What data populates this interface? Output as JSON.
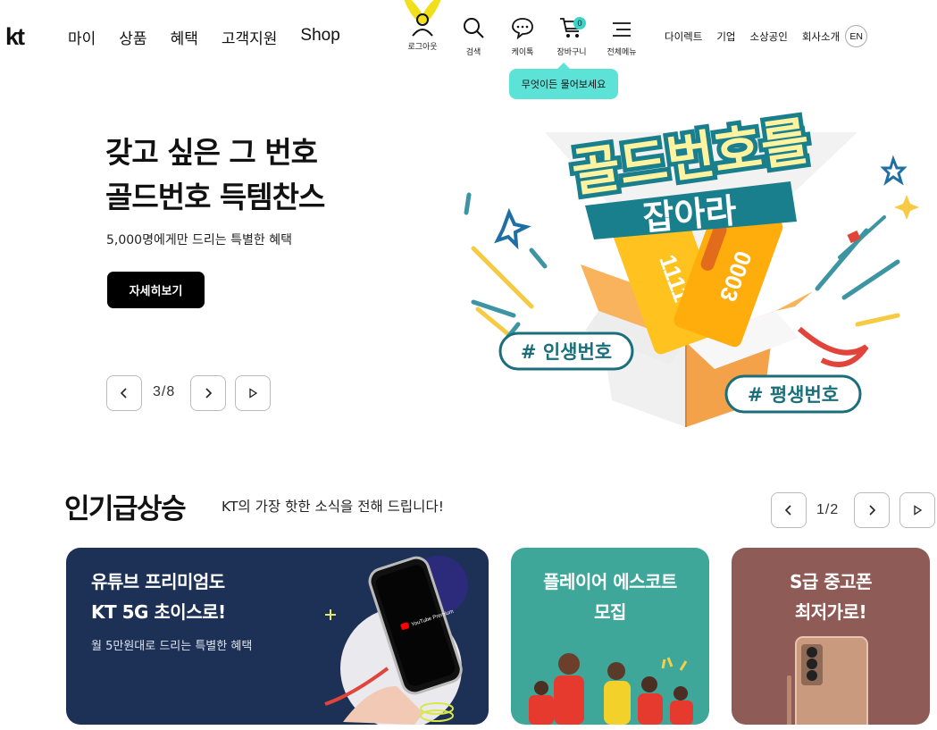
{
  "header": {
    "logo": "kt",
    "nav": [
      "마이",
      "상품",
      "혜택",
      "고객지원",
      "Shop"
    ],
    "utilities": [
      {
        "label": "로그아웃",
        "icon": "user-logout-icon"
      },
      {
        "label": "검색",
        "icon": "search-icon"
      },
      {
        "label": "케이톡",
        "icon": "chat-bubble-icon"
      },
      {
        "label": "장바구니",
        "icon": "cart-icon",
        "badge": "0"
      },
      {
        "label": "전체메뉴",
        "icon": "menu-icon"
      }
    ],
    "links": [
      "다이렉트",
      "기업",
      "소상공인",
      "회사소개"
    ],
    "lang": "EN",
    "tooltip": "무엇이든 물어보세요"
  },
  "hero": {
    "title_line1": "갖고 싶은 그 번호",
    "title_line2": "골드번호 득템찬스",
    "subtitle": "5,000명에게만 드리는 특별한 혜택",
    "button": "자세히보기",
    "page_current": "3",
    "page_total": "8",
    "page_text": "3/8",
    "art": {
      "headline1": "골드번호를",
      "headline2": "잡아라",
      "tag1": "# 인생번호",
      "tag2": "# 평생번호",
      "ticket1": "1111",
      "ticket2": "0003",
      "ticket_label": "골드번호"
    }
  },
  "trending": {
    "title": "인기급상승",
    "subtitle": "KT의 가장 핫한 소식을 전해 드립니다!",
    "page_text": "1/2",
    "cards": [
      {
        "title_line1": "유튜브 프리미엄도",
        "title_line2": "KT 5G 초이스로!",
        "subtitle": "월 5만원대로 드리는 특별한 혜택",
        "phone_text": "YouTube Premium"
      },
      {
        "title_line1": "플레이어 에스코트",
        "title_line2": "모집"
      },
      {
        "title_line1": "S급 중고폰",
        "title_line2": "최저가로!"
      }
    ]
  },
  "colors": {
    "accent": "#5de2d7",
    "kt_yellow": "#f2df1b",
    "card1_bg": "#1d3156",
    "card2_bg": "#3fa79a",
    "card3_bg": "#8e5b56",
    "hero_teal": "#1a7f8c"
  }
}
